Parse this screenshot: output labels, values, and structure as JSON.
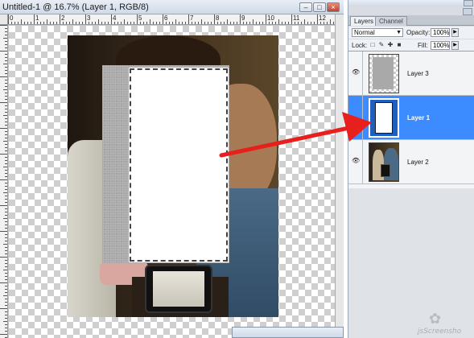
{
  "document": {
    "title": "Untitled-1 @ 16.7% (Layer 1, RGB/8)",
    "window_buttons": {
      "minimize": "–",
      "maximize": "□",
      "close": "×"
    },
    "ruler_top_numbers": [
      "0",
      "1",
      "2",
      "3",
      "4",
      "5",
      "6",
      "7",
      "8",
      "9",
      "10",
      "11",
      "12"
    ],
    "ruler_left_numbers": [
      "0",
      "1",
      "2",
      "3",
      "4",
      "5",
      "6",
      "7",
      "8",
      "9"
    ]
  },
  "layers_panel": {
    "tabs": [
      {
        "label": "Layers",
        "active": true
      },
      {
        "label": "Channel",
        "active": false
      }
    ],
    "blend_mode": "Normal",
    "opacity_label": "Opacity:",
    "opacity_value": "100%",
    "lock_label": "Lock:",
    "fill_label": "Fill:",
    "fill_value": "100%",
    "lock_icons": [
      "transparency-lock-icon",
      "brush-lock-icon",
      "move-lock-icon",
      "padlock-icon"
    ],
    "layers": [
      {
        "name": "Layer 3",
        "visible": true,
        "selected": false
      },
      {
        "name": "Layer 1",
        "visible": false,
        "selected": true
      },
      {
        "name": "Layer 2",
        "visible": true,
        "selected": false
      }
    ]
  },
  "overlay": {
    "arrow_color": "#e8201d",
    "selection_color": "#3c8cff"
  },
  "watermark": {
    "text": "jsScreensho"
  }
}
